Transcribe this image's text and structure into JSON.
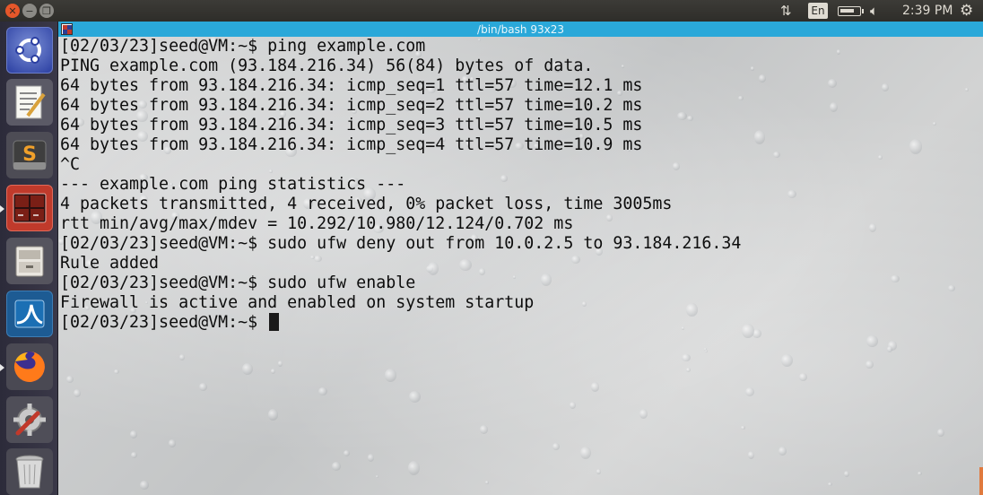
{
  "panel": {
    "keyboard_lang": "En",
    "battery_level": 0.8,
    "clock": "2:39 PM"
  },
  "launcher": {
    "items": [
      {
        "name": "ubuntu-dash",
        "icon": "ubuntu-logo-icon"
      },
      {
        "name": "text-editor",
        "icon": "text-editor-icon"
      },
      {
        "name": "sublime-text",
        "icon": "sublime-text-icon",
        "glyph": "S"
      },
      {
        "name": "terminal",
        "icon": "terminal-icon",
        "running": true
      },
      {
        "name": "files",
        "icon": "file-cabinet-icon"
      },
      {
        "name": "wireshark",
        "icon": "wireshark-icon"
      },
      {
        "name": "firefox",
        "icon": "firefox-icon",
        "running": true
      },
      {
        "name": "system-settings",
        "icon": "settings-icon"
      },
      {
        "name": "trash",
        "icon": "trash-icon"
      }
    ]
  },
  "terminal": {
    "title": "/bin/bash 93x23",
    "lines": [
      "[02/03/23]seed@VM:~$ ping example.com",
      "PING example.com (93.184.216.34) 56(84) bytes of data.",
      "64 bytes from 93.184.216.34: icmp_seq=1 ttl=57 time=12.1 ms",
      "64 bytes from 93.184.216.34: icmp_seq=2 ttl=57 time=10.2 ms",
      "64 bytes from 93.184.216.34: icmp_seq=3 ttl=57 time=10.5 ms",
      "64 bytes from 93.184.216.34: icmp_seq=4 ttl=57 time=10.9 ms",
      "^C",
      "--- example.com ping statistics ---",
      "4 packets transmitted, 4 received, 0% packet loss, time 3005ms",
      "rtt min/avg/max/mdev = 10.292/10.980/12.124/0.702 ms",
      "[02/03/23]seed@VM:~$ sudo ufw deny out from 10.0.2.5 to 93.184.216.34",
      "Rule added",
      "[02/03/23]seed@VM:~$ sudo ufw enable",
      "Firewall is active and enabled on system startup"
    ],
    "prompt": "[02/03/23]seed@VM:~$ "
  }
}
